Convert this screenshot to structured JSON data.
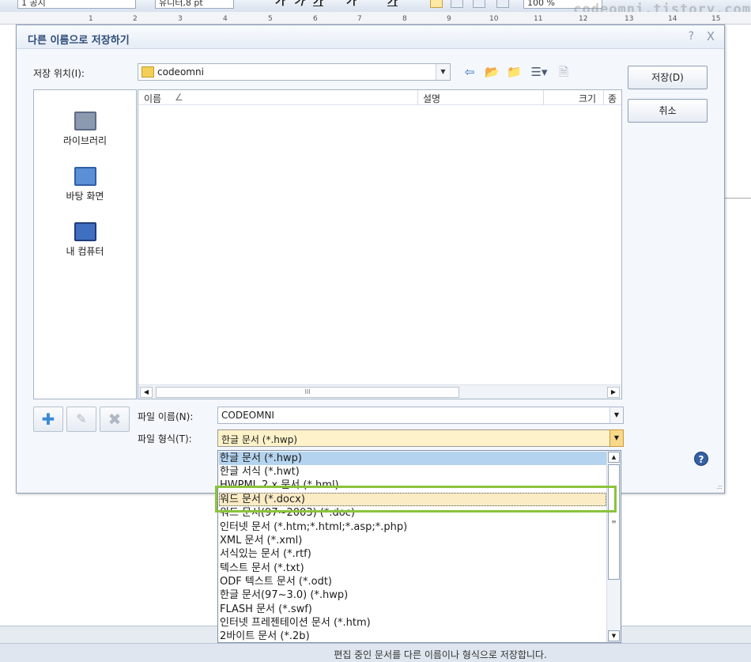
{
  "toolbar": {
    "style_value": "1 공지",
    "font_value": "유니터,8",
    "size_unit": "pt",
    "zoom_value": "100",
    "zoom_unit": "%",
    "bold": "가",
    "italic": "가",
    "underline": "가",
    "strike": "가",
    "fontcolor": "가"
  },
  "watermark": "codeomni.tistory.com",
  "ruler": [
    "1",
    "2",
    "3",
    "4",
    "5",
    "6",
    "7",
    "8",
    "9",
    "10",
    "11",
    "12",
    "13",
    "14",
    "15"
  ],
  "dialog": {
    "title": "다른 이름으로 저장하기",
    "help_icon": "?",
    "close_icon": "X",
    "location_label": "저장 위치(I):",
    "location_value": "codeomni",
    "places": [
      {
        "label": "라이브러리",
        "icon": "library-icon"
      },
      {
        "label": "바탕 화면",
        "icon": "desktop-icon"
      },
      {
        "label": "내 컴퓨터",
        "icon": "computer-icon"
      }
    ],
    "columns": {
      "name": "이름",
      "sort_mark": "∠",
      "desc": "설명",
      "size": "크기",
      "type": "종"
    },
    "save_button": "저장(D)",
    "cancel_button": "취소",
    "filename_label": "파일 이름(N):",
    "filename_value": "CODEOMNI",
    "filetype_label": "파일 형식(T):",
    "filetype_value": "한글 문서 (*.hwp)",
    "scroll_thumb": "III"
  },
  "dropdown": {
    "items": [
      "한글 문서 (*.hwp)",
      "한글 서식 (*.hwt)",
      "HWPML 2.x 문서 (*.hml)",
      "워드 문서 (*.docx)",
      "워드 문서(97~2003) (*.doc)",
      "인터넷 문서 (*.htm;*.html;*.asp;*.php)",
      "XML 문서 (*.xml)",
      "서식있는 문서 (*.rtf)",
      "텍스트 문서 (*.txt)",
      "ODF 텍스트 문서 (*.odt)",
      "한글 문서(97~3.0) (*.hwp)",
      "FLASH 문서 (*.swf)",
      "인터넷 프레젠테이션 문서 (*.htm)",
      "2바이트 문서 (*.2b)"
    ],
    "selected_index": 0,
    "highlighted_index": 3,
    "scroll_thumb": "≡"
  },
  "status_text": "편집 중인 문서를 다른 이름이나 형식으로 저장합니다.",
  "colors": {
    "highlight_border": "#8ac43a",
    "selected": "#b4d3ee",
    "hover": "#fbecc6"
  }
}
